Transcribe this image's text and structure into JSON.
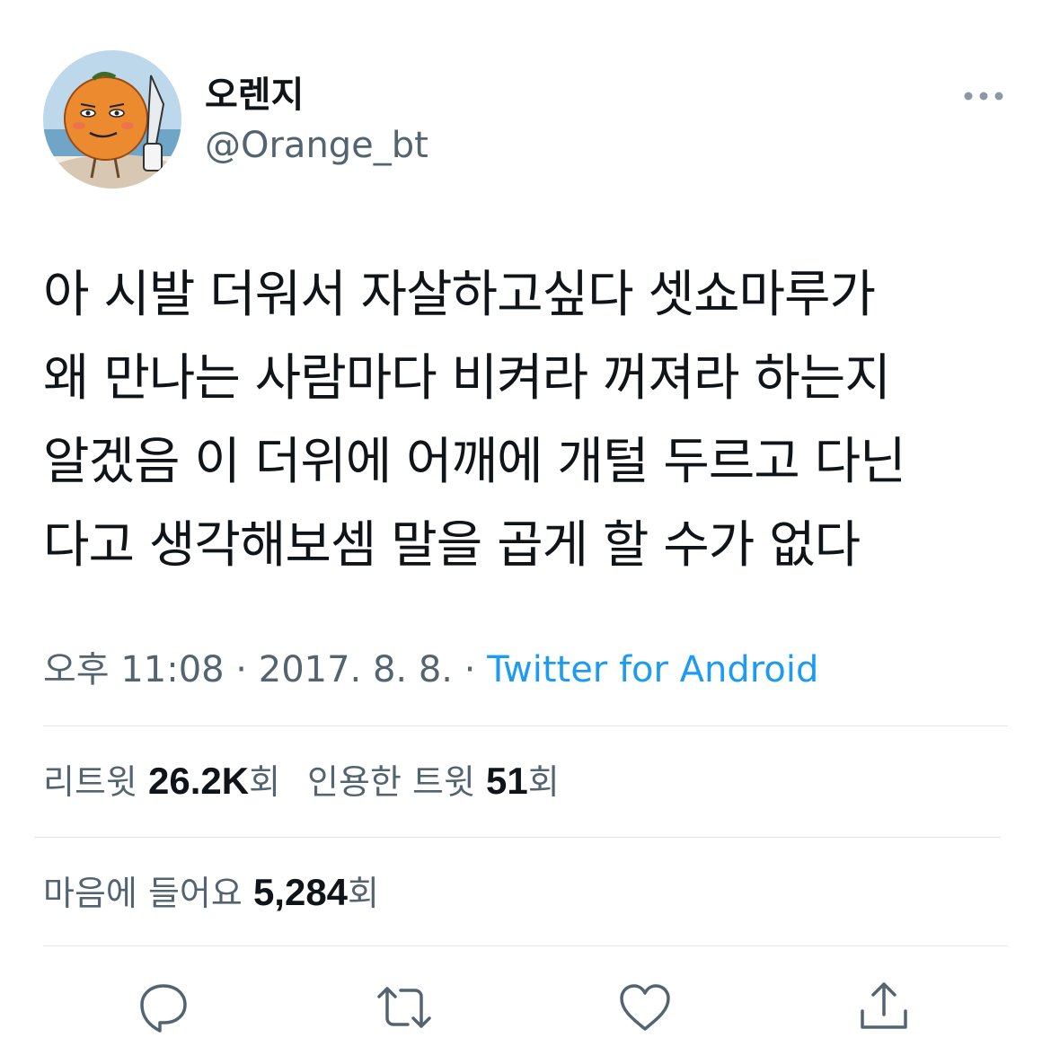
{
  "author": {
    "display_name": "오렌지",
    "handle": "@Orange_bt"
  },
  "tweet": {
    "text": "아 시발 더워서 자살하고싶다 셋쇼마루가\n왜 만나는 사람마다 비켜라 꺼져라 하는지\n알겠음 이 더위에 어깨에 개털 두르고 다닌\n다고 생각해보셈 말을 곱게 할 수가 없다",
    "time": "오후 11:08",
    "separator": " · ",
    "date": "2017. 8. 8.",
    "source": "Twitter for Android"
  },
  "stats": {
    "retweets_label": "리트윗",
    "retweets_value": "26.2K",
    "retweets_suffix": "회",
    "quotes_label": "인용한 트윗",
    "quotes_value": "51",
    "quotes_suffix": "회",
    "likes_label": "마음에 들어요",
    "likes_value": "5,284",
    "likes_suffix": "회"
  },
  "colors": {
    "link": "#1d9bf0",
    "secondary_text": "#536471",
    "primary_text": "#0f1419",
    "icon": "#536471"
  },
  "icons": [
    "more-icon",
    "reply-icon",
    "retweet-icon",
    "like-icon",
    "share-icon"
  ]
}
